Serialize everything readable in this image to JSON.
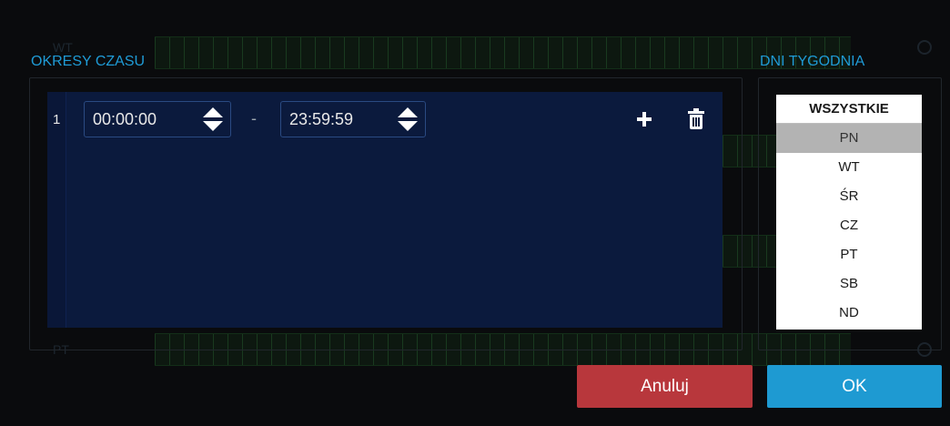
{
  "periods": {
    "title": "OKRESY CZASU",
    "rows": [
      {
        "index": "1",
        "start": "00:00:00",
        "separator": "-",
        "end": "23:59:59"
      }
    ]
  },
  "days": {
    "title": "DNI TYGODNIA",
    "all_label": "WSZYSTKIE",
    "items": [
      "PN",
      "WT",
      "ŚR",
      "CZ",
      "PT",
      "SB",
      "ND"
    ],
    "selected": "PN"
  },
  "buttons": {
    "cancel_label": "Anuluj",
    "ok_label": "OK"
  },
  "background": {
    "row_labels": [
      "WT",
      "PT"
    ]
  },
  "colors": {
    "accent": "#1f9bd6",
    "cancel": "#b8373c",
    "ok": "#1e9ad2",
    "panel": "#0b1a3d",
    "selected_day": "#b3b3b3"
  },
  "icons": [
    "spin-up-icon",
    "spin-down-icon",
    "plus-icon",
    "trash-icon"
  ]
}
